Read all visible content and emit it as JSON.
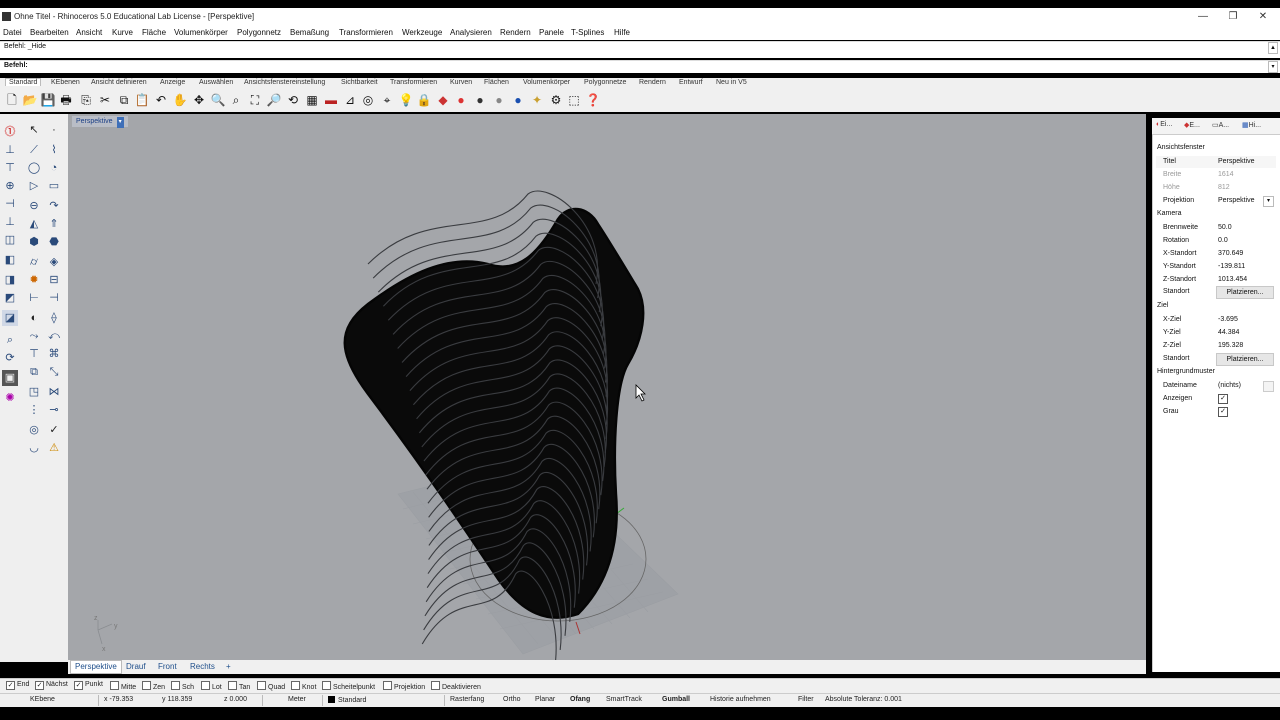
{
  "window": {
    "title": "Ohne Titel - Rhinoceros 5.0 Educational Lab License - [Perspektive]",
    "controls": [
      "—",
      "❐",
      "✕"
    ]
  },
  "menu": [
    "Datei",
    "Bearbeiten",
    "Ansicht",
    "Kurve",
    "Fläche",
    "Volumenkörper",
    "Polygonnetz",
    "Bemaßung",
    "Transformieren",
    "Werkzeuge",
    "Analysieren",
    "Rendern",
    "Panele",
    "T-Splines",
    "Hilfe"
  ],
  "command_history": "Befehl: _Hide",
  "command_prompt": "Befehl:",
  "toolbar_tabs": [
    "Standard",
    "KEbenen",
    "Ansicht definieren",
    "Anzeige",
    "Auswählen",
    "Ansichtsfenstereinstellung",
    "Sichtbarkeit",
    "Transformieren",
    "Kurven",
    "Flächen",
    "Volumenkörper",
    "Polygonnetze",
    "Rendern",
    "Entwurf",
    "Neu in V5"
  ],
  "viewport": {
    "name": "Perspektive",
    "axis_labels": [
      "x",
      "y",
      "z"
    ]
  },
  "view_tabs": [
    "Perspektive",
    "Drauf",
    "Front",
    "Rechts",
    "+"
  ],
  "osnaps": [
    {
      "label": "End",
      "checked": true
    },
    {
      "label": "Nächst",
      "checked": true
    },
    {
      "label": "Punkt",
      "checked": true
    },
    {
      "label": "Mitte",
      "checked": false
    },
    {
      "label": "Zen",
      "checked": false
    },
    {
      "label": "Sch",
      "checked": false
    },
    {
      "label": "Lot",
      "checked": false
    },
    {
      "label": "Tan",
      "checked": false
    },
    {
      "label": "Quad",
      "checked": false
    },
    {
      "label": "Knot",
      "checked": false
    },
    {
      "label": "Scheitelpunkt",
      "checked": false
    },
    {
      "label": "Projektion",
      "checked": false
    },
    {
      "label": "Deaktivieren",
      "checked": false
    }
  ],
  "status": {
    "layer": "KEbene",
    "x": "x -79.353",
    "y": "y 118.359",
    "z": "z 0.000",
    "units": "Meter",
    "current_layer": "Standard",
    "toggles": [
      "Rasterfang",
      "Ortho",
      "Planar",
      "Ofang",
      "SmartTrack",
      "Gumball",
      "Historie aufnehmen",
      "Filter"
    ],
    "bold_toggles": [
      "Ofang",
      "Gumball"
    ],
    "tolerance": "Absolute Toleranz: 0.001"
  },
  "panel": {
    "tabs": [
      "Ei...",
      "E...",
      "A...",
      "Hi..."
    ],
    "sections": {
      "viewport": "Ansichtsfenster",
      "camera": "Kamera",
      "target": "Ziel",
      "wallpaper": "Hintergrundmuster"
    },
    "properties": {
      "title": {
        "label": "Titel",
        "value": "Perspektive"
      },
      "width": {
        "label": "Breite",
        "value": "1614"
      },
      "height": {
        "label": "Höhe",
        "value": "812"
      },
      "projection": {
        "label": "Projektion",
        "value": "Perspektive"
      },
      "lens": {
        "label": "Brennweite",
        "value": "50.0"
      },
      "rotation": {
        "label": "Rotation",
        "value": "0.0"
      },
      "cam_x": {
        "label": "X-Standort",
        "value": "370.649"
      },
      "cam_y": {
        "label": "Y-Standort",
        "value": "-139.811"
      },
      "cam_z": {
        "label": "Z-Standort",
        "value": "1013.454"
      },
      "cam_loc": {
        "label": "Standort",
        "button": "Platzieren..."
      },
      "tgt_x": {
        "label": "X-Ziel",
        "value": "-3.695"
      },
      "tgt_y": {
        "label": "Y-Ziel",
        "value": "44.384"
      },
      "tgt_z": {
        "label": "Z-Ziel",
        "value": "195.328"
      },
      "tgt_loc": {
        "label": "Standort",
        "button": "Platzieren..."
      },
      "filename": {
        "label": "Dateiname",
        "value": "(nichts)"
      },
      "show": {
        "label": "Anzeigen",
        "checked": true
      },
      "gray": {
        "label": "Grau",
        "checked": true
      }
    }
  },
  "colors": {
    "viewport_bg": "#a4a6aa",
    "selection_blue": "#3e6fb8",
    "geometry": "#050505"
  }
}
